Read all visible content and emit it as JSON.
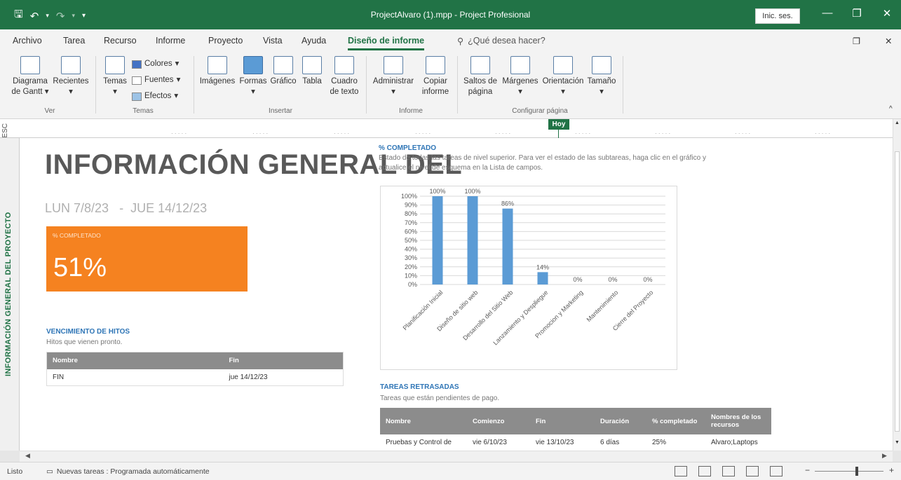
{
  "window": {
    "title": "ProjectAlvaro (1).mpp  -  Project Profesional",
    "signin_label": "Inic. ses."
  },
  "menu": {
    "tabs": [
      "Archivo",
      "Tarea",
      "Recurso",
      "Informe",
      "Proyecto",
      "Vista",
      "Ayuda",
      "Diseño de informe"
    ],
    "active_tab": "Diseño de informe",
    "tell_me": "¿Qué desea hacer?"
  },
  "ribbon": {
    "groups": [
      {
        "label": "Ver",
        "buttons": [
          "Diagrama de Gantt",
          "Recientes"
        ]
      },
      {
        "label": "Temas",
        "buttons": [
          "Temas",
          "Colores",
          "Fuentes",
          "Efectos"
        ]
      },
      {
        "label": "Insertar",
        "buttons": [
          "Imágenes",
          "Formas",
          "Gráfico",
          "Tabla",
          "Cuadro de texto"
        ]
      },
      {
        "label": "Informe",
        "buttons": [
          "Administrar",
          "Copiar informe"
        ]
      },
      {
        "label": "Configurar página",
        "buttons": [
          "Saltos de página",
          "Márgenes",
          "Orientación",
          "Tamaño"
        ]
      }
    ]
  },
  "timescale": {
    "esc_label": "ESC",
    "today_label": "Hoy"
  },
  "sidebar": {
    "label": "INFORMACIÓN GENERAL DEL PROYECTO"
  },
  "report": {
    "title": "INFORMACIÓN GENERAL DEL",
    "start_date": "LUN 7/8/23",
    "end_date": "JUE 14/12/23",
    "date_separator": "-",
    "kpi_label": "% COMPLETADO",
    "kpi_value": "51%",
    "chart_heading": "% COMPLETADO",
    "chart_description": "Estado de todas las tareas de nivel superior. Para ver el estado de las subtareas, haga clic en el gráfico y actualice el nivel de esquema en la Lista de campos.",
    "milestones": {
      "title": "VENCIMIENTO DE HITOS",
      "subtitle": "Hitos que vienen pronto.",
      "headers": [
        "Nombre",
        "Fin"
      ],
      "rows": [
        [
          "FIN",
          "jue 14/12/23"
        ]
      ]
    },
    "late_tasks": {
      "title": "TAREAS RETRASADAS",
      "subtitle": "Tareas que están pendientes de pago.",
      "headers": [
        "Nombre",
        "Comienzo",
        "Fin",
        "Duración",
        "% completado",
        "Nombres de los recursos"
      ],
      "rows": [
        [
          "Pruebas y Control de",
          "vie 6/10/23",
          "vie 13/10/23",
          "6 días",
          "25%",
          "Alvaro;Laptops"
        ]
      ]
    }
  },
  "chart_data": {
    "type": "bar",
    "categories": [
      "Planificación Inicial",
      "Diseño de sitio web",
      "Desarrollo del Sitio Web",
      "Lanzamiento y Despliegue",
      "Promocion y Marketing",
      "Mantenimiento",
      "Cierre del Proyecto"
    ],
    "values": [
      100,
      100,
      86,
      14,
      0,
      0,
      0
    ],
    "value_labels": [
      "100%",
      "100%",
      "86%",
      "14%",
      "0%",
      "0%",
      "0%"
    ],
    "y_ticks": [
      "100%",
      "90%",
      "80%",
      "70%",
      "60%",
      "50%",
      "40%",
      "30%",
      "20%",
      "10%",
      "0%"
    ],
    "ylim": [
      0,
      100
    ],
    "bar_color": "#5b9bd5",
    "grid": true
  },
  "status": {
    "ready": "Listo",
    "new_tasks": "Nuevas tareas : Programada automáticamente"
  },
  "colors": {
    "accent": "#217346",
    "kpi": "#f58220",
    "header_gray": "#8c8c8c",
    "section_blue": "#2e75b6"
  }
}
